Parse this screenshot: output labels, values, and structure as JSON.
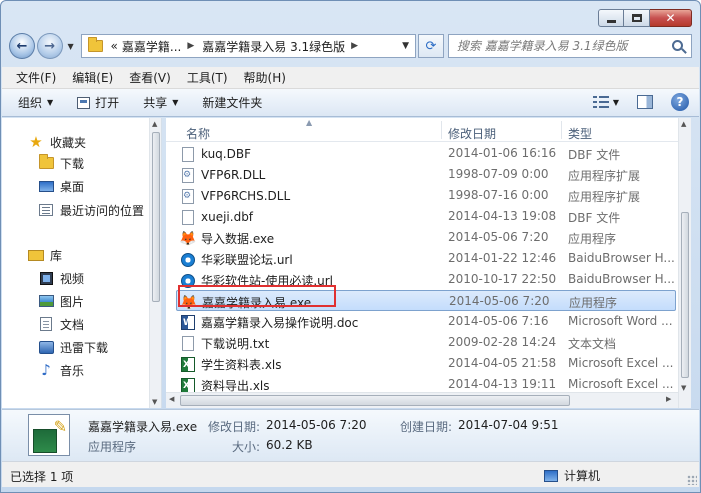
{
  "window": {
    "caption_buttons": [
      "minimize",
      "maximize",
      "close"
    ]
  },
  "navbar": {
    "breadcrumb_prefix": "«",
    "breadcrumb": [
      "嘉嘉学籍...",
      "嘉嘉学籍录入易 3.1绿色版"
    ],
    "search_placeholder": "搜索 嘉嘉学籍录入易 3.1绿色版"
  },
  "menubar": {
    "items": [
      "文件(F)",
      "编辑(E)",
      "查看(V)",
      "工具(T)",
      "帮助(H)"
    ]
  },
  "toolbar": {
    "organize": "组织",
    "open": "打开",
    "share": "共享",
    "new_folder": "新建文件夹"
  },
  "navpane": {
    "favorites": "收藏夹",
    "downloads": "下载",
    "desktop": "桌面",
    "recent": "最近访问的位置",
    "libraries": "库",
    "videos": "视频",
    "pictures": "图片",
    "documents": "文档",
    "xunlei": "迅雷下载",
    "music": "音乐"
  },
  "columns": {
    "name": "名称",
    "date": "修改日期",
    "type": "类型"
  },
  "files": [
    {
      "name": "kuq.DBF",
      "date": "2014-01-06 16:16",
      "type": "DBF 文件",
      "icon": "file-icon"
    },
    {
      "name": "VFP6R.DLL",
      "date": "1998-07-09 0:00",
      "type": "应用程序扩展",
      "icon": "dll-icon"
    },
    {
      "name": "VFP6RCHS.DLL",
      "date": "1998-07-16 0:00",
      "type": "应用程序扩展",
      "icon": "dll-icon"
    },
    {
      "name": "xueji.dbf",
      "date": "2014-04-13 19:08",
      "type": "DBF 文件",
      "icon": "file-icon"
    },
    {
      "name": "导入数据.exe",
      "date": "2014-05-06 7:20",
      "type": "应用程序",
      "icon": "fox-icon"
    },
    {
      "name": "华彩联盟论坛.url",
      "date": "2014-01-22 12:46",
      "type": "BaiduBrowser H...",
      "icon": "url-icon"
    },
    {
      "name": "华彩软件站-使用必读.url",
      "date": "2010-10-17 22:50",
      "type": "BaiduBrowser H...",
      "icon": "url-icon"
    },
    {
      "name": "嘉嘉学籍录入易.exe",
      "date": "2014-05-06 7:20",
      "type": "应用程序",
      "icon": "fox-icon",
      "selected": true
    },
    {
      "name": "嘉嘉学籍录入易操作说明.doc",
      "date": "2014-05-06 7:16",
      "type": "Microsoft Word ...",
      "icon": "word-icon"
    },
    {
      "name": "下载说明.txt",
      "date": "2009-02-28 14:24",
      "type": "文本文档",
      "icon": "file-icon"
    },
    {
      "name": "学生资料表.xls",
      "date": "2014-04-05 21:58",
      "type": "Microsoft Excel ...",
      "icon": "excel-icon"
    },
    {
      "name": "资料导出.xls",
      "date": "2014-04-13 19:11",
      "type": "Microsoft Excel ...",
      "icon": "excel-icon"
    }
  ],
  "details": {
    "file_name": "嘉嘉学籍录入易.exe",
    "modified_label": "修改日期:",
    "modified_value": "2014-05-06 7:20",
    "created_label": "创建日期:",
    "created_value": "2014-07-04 9:51",
    "type_value": "应用程序",
    "size_label": "大小:",
    "size_value": "60.2 KB"
  },
  "status": {
    "selected": "已选择 1 项",
    "location": "计算机"
  }
}
